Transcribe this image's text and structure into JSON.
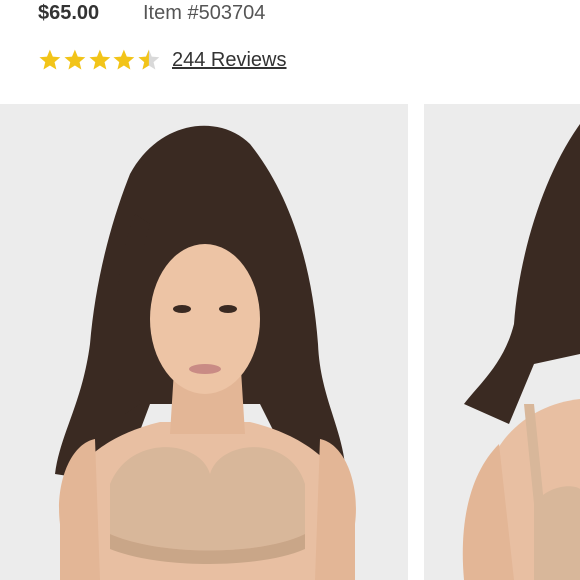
{
  "product": {
    "price": "$65.00",
    "item_number": "Item #503704",
    "rating": 4.5,
    "rating_max": 5,
    "reviews_label": "244 Reviews"
  },
  "colors": {
    "star_fill": "#f2c418",
    "star_empty": "#d9d9d9",
    "text": "#333333",
    "image_background": "#ececec"
  },
  "images": {
    "main_alt": "product-photo-front",
    "next_alt": "product-photo-side"
  }
}
